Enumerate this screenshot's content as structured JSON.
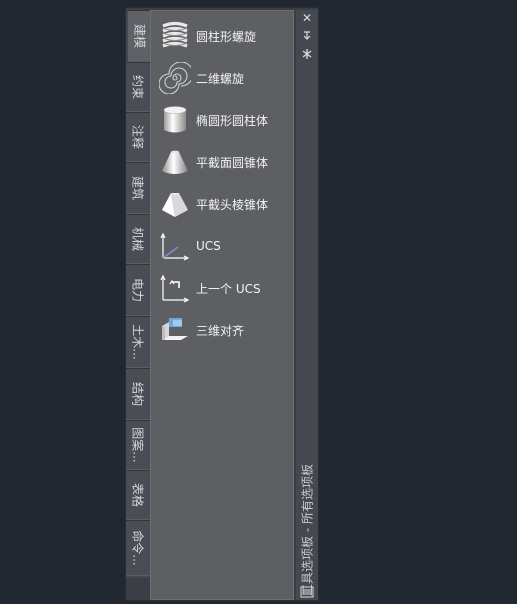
{
  "tabs": [
    {
      "label": "建模",
      "active": true
    },
    {
      "label": "约束"
    },
    {
      "label": "注释"
    },
    {
      "label": "建筑"
    },
    {
      "label": "机械"
    },
    {
      "label": "电力"
    },
    {
      "label": "土木..."
    },
    {
      "label": "结构"
    },
    {
      "label": "图案..."
    },
    {
      "label": "表格"
    },
    {
      "label": "命令..."
    }
  ],
  "tools": [
    {
      "label": "圆柱形螺旋",
      "icon": "cylindrical-helix-icon"
    },
    {
      "label": "二维螺旋",
      "icon": "spiral-icon"
    },
    {
      "label": "椭圆形圆柱体",
      "icon": "elliptical-cylinder-icon"
    },
    {
      "label": "平截面圆锥体",
      "icon": "frustum-cone-icon"
    },
    {
      "label": "平截头棱锥体",
      "icon": "frustum-pyramid-icon"
    },
    {
      "label": "UCS",
      "icon": "ucs-icon"
    },
    {
      "label": "上一个 UCS",
      "icon": "previous-ucs-icon"
    },
    {
      "label": "三维对齐",
      "icon": "3d-align-icon"
    }
  ],
  "rail": {
    "title": "工具选项板 - 所有选项板",
    "close_icon": "close-icon",
    "autohide_icon": "autohide-icon",
    "properties_icon": "properties-icon",
    "menu_icon": "palette-menu-icon"
  }
}
